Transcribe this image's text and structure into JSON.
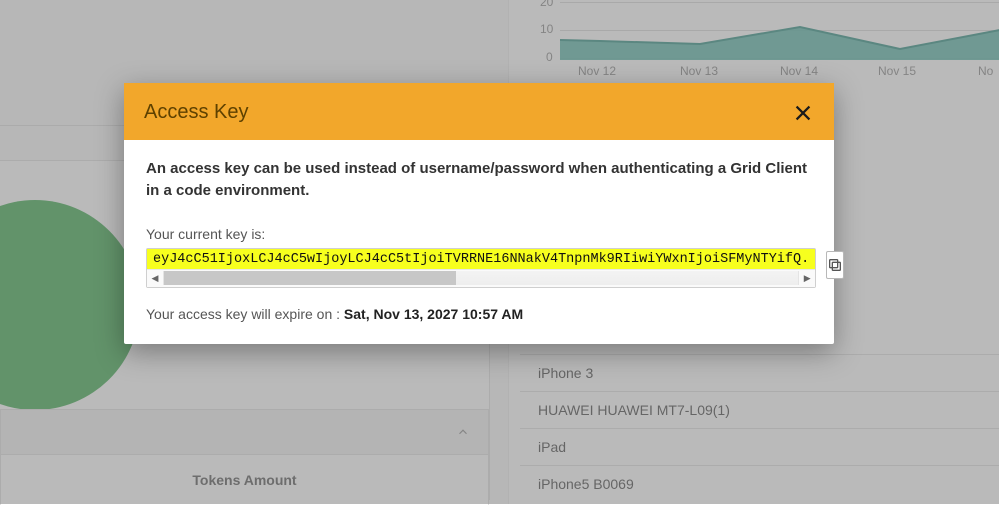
{
  "modal": {
    "title": "Access Key",
    "description": "An access key can be used instead of username/password when authenticating a Grid Client in a code environment.",
    "current_key_label": "Your current key is:",
    "key_value": "eyJ4cC51IjoxLCJ4cC5wIjoyLCJ4cC5tIjoiTVRRNE16NNakV4TnpnMk9RIiwiYWxnIjoiSFMyNTYifQ.",
    "expire_prefix": "Your access key will expire on : ",
    "expire_date": "Sat, Nov 13, 2027 10:57 AM"
  },
  "bg": {
    "tokens_heading": "Tokens Amount",
    "devices": [
      "iPhone 3",
      "HUAWEI HUAWEI MT7-L09(1)",
      "iPad",
      "iPhone5 B0069"
    ]
  },
  "chart_data": {
    "type": "area",
    "categories": [
      "Nov 12",
      "Nov 13",
      "Nov 14",
      "Nov 15",
      "No"
    ],
    "values": [
      7,
      6,
      11,
      4,
      10
    ],
    "ylim": [
      0,
      20
    ],
    "yticks": [
      0,
      10,
      20
    ],
    "ylabel": "",
    "xlabel": "",
    "title": ""
  }
}
